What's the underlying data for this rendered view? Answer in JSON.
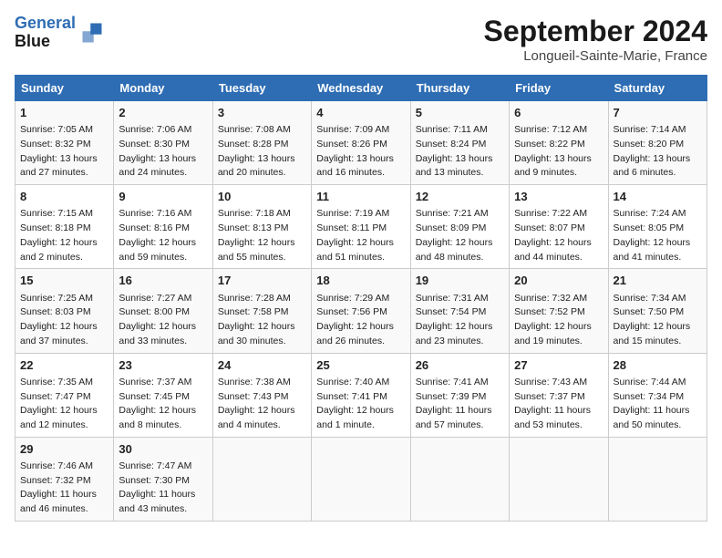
{
  "header": {
    "logo_line1": "General",
    "logo_line2": "Blue",
    "month": "September 2024",
    "location": "Longueil-Sainte-Marie, France"
  },
  "weekdays": [
    "Sunday",
    "Monday",
    "Tuesday",
    "Wednesday",
    "Thursday",
    "Friday",
    "Saturday"
  ],
  "weeks": [
    [
      {
        "day": "1",
        "sunrise": "7:05 AM",
        "sunset": "8:32 PM",
        "daylight": "13 hours and 27 minutes."
      },
      {
        "day": "2",
        "sunrise": "7:06 AM",
        "sunset": "8:30 PM",
        "daylight": "13 hours and 24 minutes."
      },
      {
        "day": "3",
        "sunrise": "7:08 AM",
        "sunset": "8:28 PM",
        "daylight": "13 hours and 20 minutes."
      },
      {
        "day": "4",
        "sunrise": "7:09 AM",
        "sunset": "8:26 PM",
        "daylight": "13 hours and 16 minutes."
      },
      {
        "day": "5",
        "sunrise": "7:11 AM",
        "sunset": "8:24 PM",
        "daylight": "13 hours and 13 minutes."
      },
      {
        "day": "6",
        "sunrise": "7:12 AM",
        "sunset": "8:22 PM",
        "daylight": "13 hours and 9 minutes."
      },
      {
        "day": "7",
        "sunrise": "7:14 AM",
        "sunset": "8:20 PM",
        "daylight": "13 hours and 6 minutes."
      }
    ],
    [
      {
        "day": "8",
        "sunrise": "7:15 AM",
        "sunset": "8:18 PM",
        "daylight": "12 hours and 2 minutes."
      },
      {
        "day": "9",
        "sunrise": "7:16 AM",
        "sunset": "8:16 PM",
        "daylight": "12 hours and 59 minutes."
      },
      {
        "day": "10",
        "sunrise": "7:18 AM",
        "sunset": "8:13 PM",
        "daylight": "12 hours and 55 minutes."
      },
      {
        "day": "11",
        "sunrise": "7:19 AM",
        "sunset": "8:11 PM",
        "daylight": "12 hours and 51 minutes."
      },
      {
        "day": "12",
        "sunrise": "7:21 AM",
        "sunset": "8:09 PM",
        "daylight": "12 hours and 48 minutes."
      },
      {
        "day": "13",
        "sunrise": "7:22 AM",
        "sunset": "8:07 PM",
        "daylight": "12 hours and 44 minutes."
      },
      {
        "day": "14",
        "sunrise": "7:24 AM",
        "sunset": "8:05 PM",
        "daylight": "12 hours and 41 minutes."
      }
    ],
    [
      {
        "day": "15",
        "sunrise": "7:25 AM",
        "sunset": "8:03 PM",
        "daylight": "12 hours and 37 minutes."
      },
      {
        "day": "16",
        "sunrise": "7:27 AM",
        "sunset": "8:00 PM",
        "daylight": "12 hours and 33 minutes."
      },
      {
        "day": "17",
        "sunrise": "7:28 AM",
        "sunset": "7:58 PM",
        "daylight": "12 hours and 30 minutes."
      },
      {
        "day": "18",
        "sunrise": "7:29 AM",
        "sunset": "7:56 PM",
        "daylight": "12 hours and 26 minutes."
      },
      {
        "day": "19",
        "sunrise": "7:31 AM",
        "sunset": "7:54 PM",
        "daylight": "12 hours and 23 minutes."
      },
      {
        "day": "20",
        "sunrise": "7:32 AM",
        "sunset": "7:52 PM",
        "daylight": "12 hours and 19 minutes."
      },
      {
        "day": "21",
        "sunrise": "7:34 AM",
        "sunset": "7:50 PM",
        "daylight": "12 hours and 15 minutes."
      }
    ],
    [
      {
        "day": "22",
        "sunrise": "7:35 AM",
        "sunset": "7:47 PM",
        "daylight": "12 hours and 12 minutes."
      },
      {
        "day": "23",
        "sunrise": "7:37 AM",
        "sunset": "7:45 PM",
        "daylight": "12 hours and 8 minutes."
      },
      {
        "day": "24",
        "sunrise": "7:38 AM",
        "sunset": "7:43 PM",
        "daylight": "12 hours and 4 minutes."
      },
      {
        "day": "25",
        "sunrise": "7:40 AM",
        "sunset": "7:41 PM",
        "daylight": "12 hours and 1 minute."
      },
      {
        "day": "26",
        "sunrise": "7:41 AM",
        "sunset": "7:39 PM",
        "daylight": "11 hours and 57 minutes."
      },
      {
        "day": "27",
        "sunrise": "7:43 AM",
        "sunset": "7:37 PM",
        "daylight": "11 hours and 53 minutes."
      },
      {
        "day": "28",
        "sunrise": "7:44 AM",
        "sunset": "7:34 PM",
        "daylight": "11 hours and 50 minutes."
      }
    ],
    [
      {
        "day": "29",
        "sunrise": "7:46 AM",
        "sunset": "7:32 PM",
        "daylight": "11 hours and 46 minutes."
      },
      {
        "day": "30",
        "sunrise": "7:47 AM",
        "sunset": "7:30 PM",
        "daylight": "11 hours and 43 minutes."
      },
      null,
      null,
      null,
      null,
      null
    ]
  ]
}
